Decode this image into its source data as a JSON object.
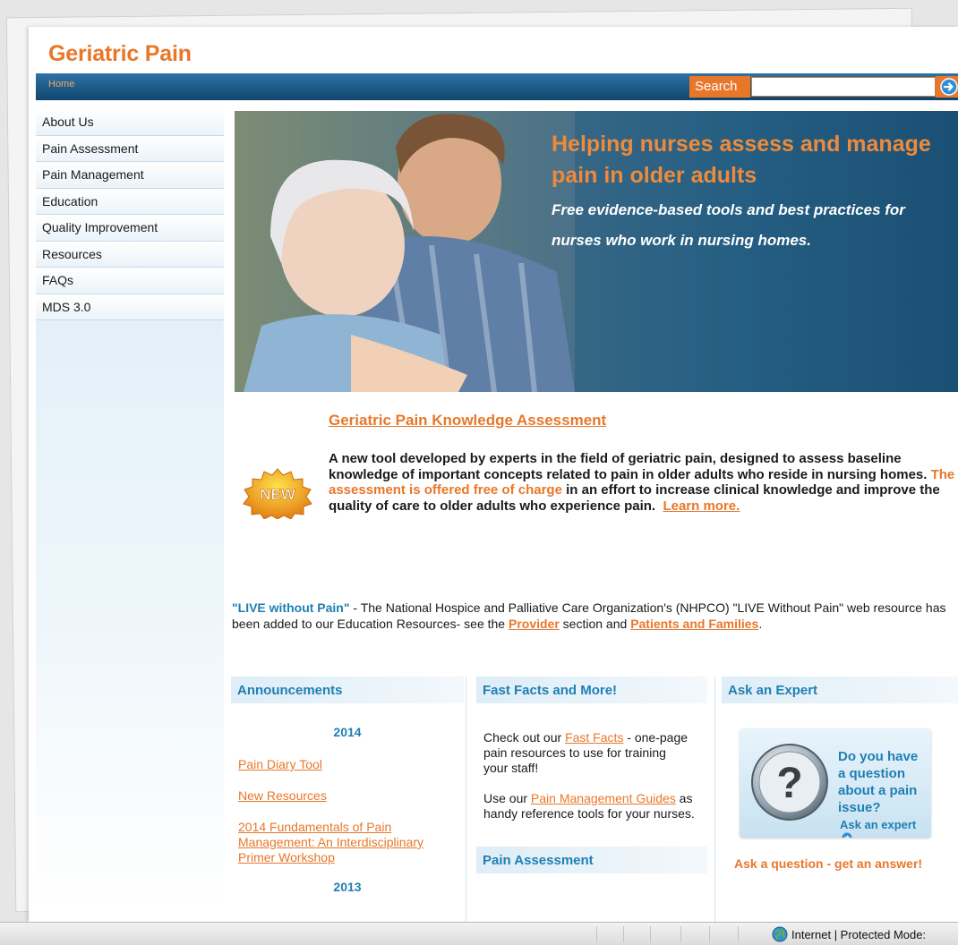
{
  "site": {
    "logo": "Geriatric Pain"
  },
  "nav": {
    "home": "Home",
    "search_label": "Search",
    "search_value": ""
  },
  "sidebar": {
    "items": [
      {
        "label": "About Us"
      },
      {
        "label": "Pain Assessment"
      },
      {
        "label": "Pain Management"
      },
      {
        "label": "Education"
      },
      {
        "label": "Quality Improvement"
      },
      {
        "label": "Resources"
      },
      {
        "label": "FAQs"
      },
      {
        "label": "MDS 3.0"
      }
    ]
  },
  "hero": {
    "heading": "Helping nurses assess and manage pain in older adults",
    "subheading": "Free evidence-based tools and best practices for nurses who work in nursing homes."
  },
  "knowledge": {
    "badge": "NEW",
    "title": "Geriatric Pain Knowledge Assessment",
    "text_1": "A new tool developed by experts in the field of geriatric pain, designed to assess baseline knowledge of important concepts related to pain in older adults who reside in nursing homes.",
    "text_highlight": "The assessment is offered free of charge",
    "text_2": "in an effort to increase clinical knowledge and improve the quality of care to older adults who experience pain.",
    "learn_more": "Learn more."
  },
  "live": {
    "strong": "\"LIVE without Pain\"",
    "text_1": " - The National Hospice and Palliative Care Organization's (NHPCO) \"LIVE Without Pain\" web resource has been added to our Education Resources- see the ",
    "provider_link": "Provider",
    "text_2": " section and ",
    "families_link": "Patients and Families",
    "text_3": "."
  },
  "announcements": {
    "title": "Announcements",
    "year_1": "2014",
    "links": [
      {
        "label": "Pain Diary Tool"
      },
      {
        "label": "New Resources"
      },
      {
        "label": "2014 Fundamentals of Pain Management: An Interdisciplinary Primer Workshop"
      }
    ],
    "year_2": "2013"
  },
  "fast_facts": {
    "title": "Fast Facts and More!",
    "p1_a": "Check out our ",
    "p1_link": "Fast Facts",
    "p1_b": " - one-page pain resources to use for training your staff!",
    "p2_a": "Use our ",
    "p2_link": "Pain Management Guides",
    "p2_b": " as handy reference tools for your nurses.",
    "sub_title": "Pain Assessment"
  },
  "expert": {
    "title": "Ask an Expert",
    "question": "Do you have a question about a pain issue?",
    "link": "Ask an expert",
    "answer": "Ask a question - get  an answer!"
  },
  "statusbar": {
    "text": "Internet | Protected Mode: "
  },
  "colors": {
    "brand_orange": "#e8772a",
    "nav_blue": "#11466e",
    "heading_blue": "#1f7fb4"
  }
}
